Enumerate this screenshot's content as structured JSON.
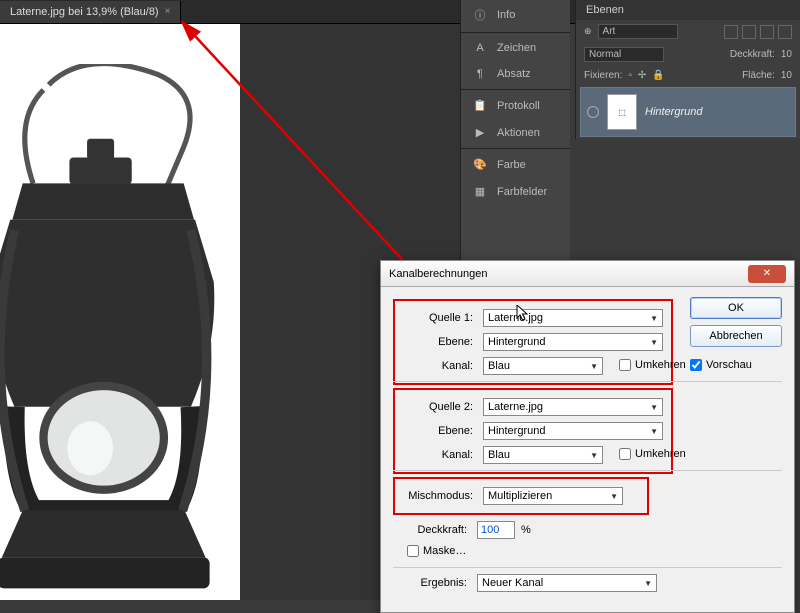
{
  "tab": {
    "title": "Laterne.jpg bei 13,9% (Blau/8)",
    "close": "×"
  },
  "panels": {
    "info": "Info",
    "zeichen": "Zeichen",
    "absatz": "Absatz",
    "protokoll": "Protokoll",
    "aktionen": "Aktionen",
    "farbe": "Farbe",
    "farbfelder": "Farbfelder"
  },
  "panel_icons": {
    "info": "ⓘ",
    "zeichen": "A",
    "absatz": "¶",
    "protokoll": "📋",
    "aktionen": "▶",
    "farbe": "🎨",
    "farbfelder": "▦"
  },
  "ebenen": {
    "title": "Ebenen",
    "kind": "Art",
    "blend": "Normal",
    "opacity_label": "Deckkraft:",
    "opacity_value": "10",
    "lock_label": "Fixieren:",
    "fill_label": "Fläche:",
    "fill_value": "10",
    "layer_name": "Hintergrund"
  },
  "dialog": {
    "title": "Kanalberechnungen",
    "quelle1_label": "Quelle 1:",
    "quelle1_value": "Laterne.jpg",
    "ebene_label": "Ebene:",
    "ebene_value": "Hintergrund",
    "kanal_label": "Kanal:",
    "kanal_value": "Blau",
    "umkehren": "Umkehren",
    "quelle2_label": "Quelle 2:",
    "quelle2_value": "Laterne.jpg",
    "misch_label": "Mischmodus:",
    "misch_value": "Multiplizieren",
    "deck_label": "Deckkraft:",
    "deck_value": "100",
    "deck_unit": "%",
    "maske": "Maske…",
    "ergebnis_label": "Ergebnis:",
    "ergebnis_value": "Neuer Kanal",
    "ok": "OK",
    "cancel": "Abbrechen",
    "vorschau": "Vorschau"
  }
}
